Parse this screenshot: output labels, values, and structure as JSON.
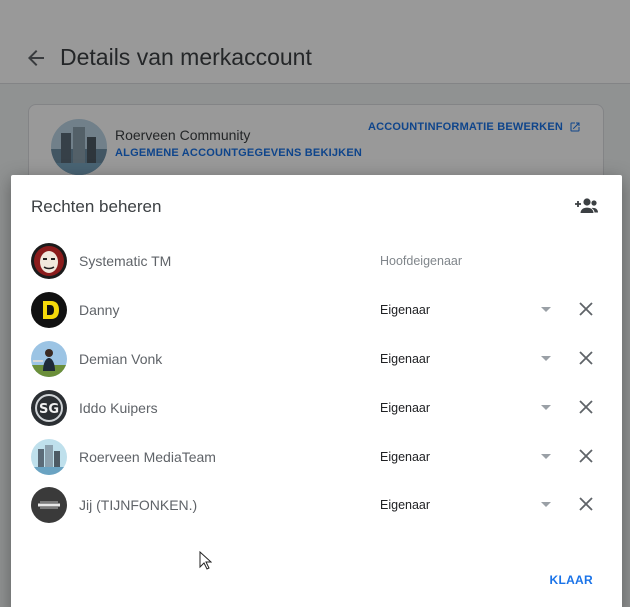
{
  "page": {
    "title": "Details van merkaccount"
  },
  "account_card": {
    "name": "Roerveen Community",
    "view_link": "ALGEMENE ACCOUNTGEGEVENS BEKIJKEN",
    "edit_link": "ACCOUNTINFORMATIE BEWERKEN",
    "edit_icon": "open-in-new-icon"
  },
  "dialog": {
    "title": "Rechten beheren",
    "add_icon": "add-person-icon",
    "done_label": "KLAAR",
    "users": [
      {
        "name": "Systematic TM",
        "role": "Hoofdeigenaar",
        "avatar": "mask"
      },
      {
        "name": "Danny",
        "role": "Eigenaar",
        "avatar": "letter-d"
      },
      {
        "name": "Demian Vonk",
        "role": "Eigenaar",
        "avatar": "photo-person"
      },
      {
        "name": "Iddo Kuipers",
        "role": "Eigenaar",
        "avatar": "sg-logo"
      },
      {
        "name": "Roerveen MediaTeam",
        "role": "Eigenaar",
        "avatar": "building"
      },
      {
        "name": "Jij (TIJNFONKEN.)",
        "role": "Eigenaar",
        "avatar": "tijnfonken-logo"
      }
    ]
  },
  "colors": {
    "accent": "#1a73e8",
    "scrim": "rgba(0,0,0,0.4)"
  }
}
